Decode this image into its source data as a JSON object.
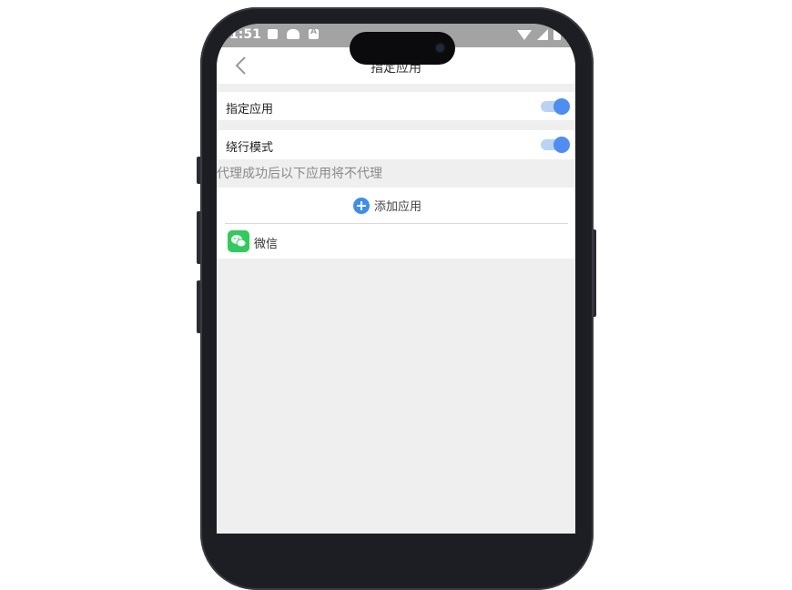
{
  "status_bar": {
    "time": "1:51",
    "icons": [
      "image-icon",
      "vpn-icon",
      "text-a-icon",
      "wifi-icon",
      "signal-icon",
      "battery-icon"
    ]
  },
  "nav": {
    "title": "指定应用",
    "back_icon": "chevron-left-icon"
  },
  "settings": {
    "specify_apps": {
      "label": "指定应用",
      "enabled": true
    },
    "bypass_mode": {
      "label": "绕行模式",
      "enabled": true
    }
  },
  "hint_text": "代理成功后以下应用将不代理",
  "add_app": {
    "label": "添加应用",
    "icon": "plus-circle-icon"
  },
  "apps": [
    {
      "name": "微信",
      "icon": "wechat-icon"
    }
  ],
  "colors": {
    "accent": "#4d8ef2",
    "toggle_track": "#b8d3f6",
    "plus_icon": "#3e8df2",
    "wechat": "#2ecc5a",
    "screen_bg": "#efefef",
    "status_bar": "#a3a3a3"
  }
}
